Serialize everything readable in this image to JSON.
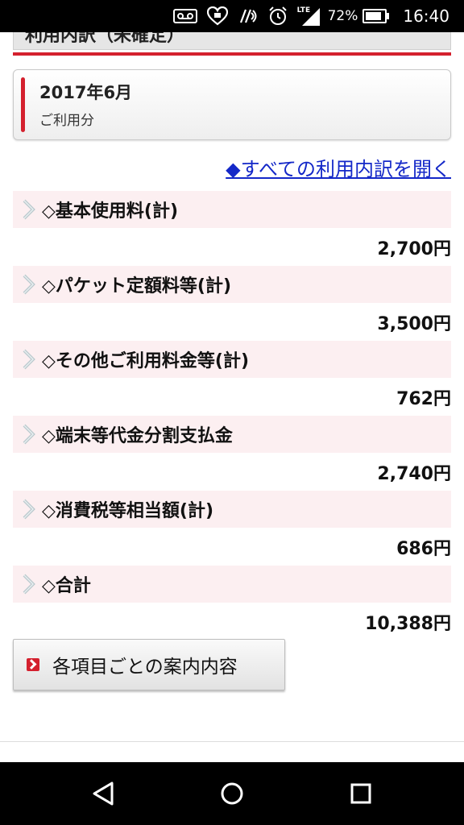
{
  "status_bar": {
    "battery_percent": "72%",
    "time": "16:40",
    "signal_label": "LTE",
    "icons": [
      "voicemail-icon",
      "heart-app-icon",
      "nfc-icon",
      "alarm-icon",
      "signal-icon",
      "battery-icon"
    ]
  },
  "header": {
    "section_title": "利用内訳（未確定）"
  },
  "month_box": {
    "month": "2017年6月",
    "sub": "ご利用分"
  },
  "open_all_link": "◆すべての利用内訳を開く",
  "items": [
    {
      "title": "◇基本使用料(計)",
      "amount": "2,700円"
    },
    {
      "title": "◇パケット定額料等(計)",
      "amount": "3,500円"
    },
    {
      "title": "◇その他ご利用料金等(計)",
      "amount": "762円"
    },
    {
      "title": "◇端末等代金分割支払金",
      "amount": "2,740円"
    },
    {
      "title": "◇消費税等相当額(計)",
      "amount": "686円"
    },
    {
      "title": "◇合計",
      "amount": "10,388円"
    }
  ],
  "guide_button": {
    "label": "各項目ごとの案内内容"
  },
  "nav_bar": {
    "buttons": [
      "back-icon",
      "home-icon",
      "recents-icon"
    ]
  },
  "colors": {
    "accent_red": "#d4202e",
    "link_blue": "#1428c8",
    "row_pink": "#fceff1"
  }
}
